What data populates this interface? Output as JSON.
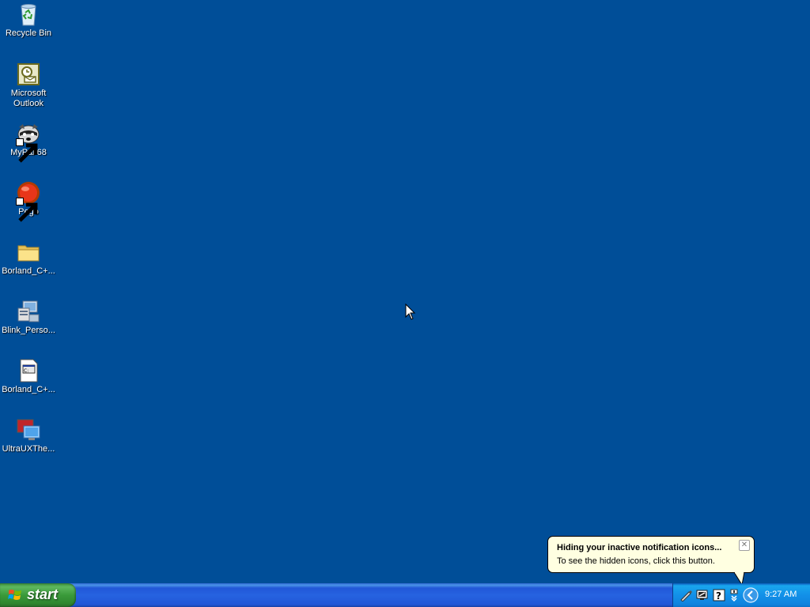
{
  "desktop": {
    "background": "#004e98",
    "icons": [
      {
        "label": "Recycle Bin",
        "icon": "recycle-bin-icon"
      },
      {
        "label": "Microsoft Outlook",
        "icon": "outlook-icon"
      },
      {
        "label": "MyPal 68",
        "icon": "mypal-icon"
      },
      {
        "label": "Pego",
        "icon": "pego-icon"
      },
      {
        "label": "Borland_C+...",
        "icon": "folder-icon"
      },
      {
        "label": "Blink_Perso...",
        "icon": "blink-icon"
      },
      {
        "label": "Borland_C+...",
        "icon": "document-icon"
      },
      {
        "label": "UltraUXThe...",
        "icon": "display-icon"
      }
    ]
  },
  "balloon": {
    "title": "Hiding your inactive notification icons...",
    "text": "To see the hidden icons, click this button.",
    "close_label": "✕"
  },
  "taskbar": {
    "start_label": "start",
    "tray_icons": [
      "pen-tool-icon",
      "network-monitor-icon",
      "help-icon",
      "safely-remove-icon",
      "show-hidden-icons-chevron"
    ],
    "clock": "9:27 AM"
  }
}
